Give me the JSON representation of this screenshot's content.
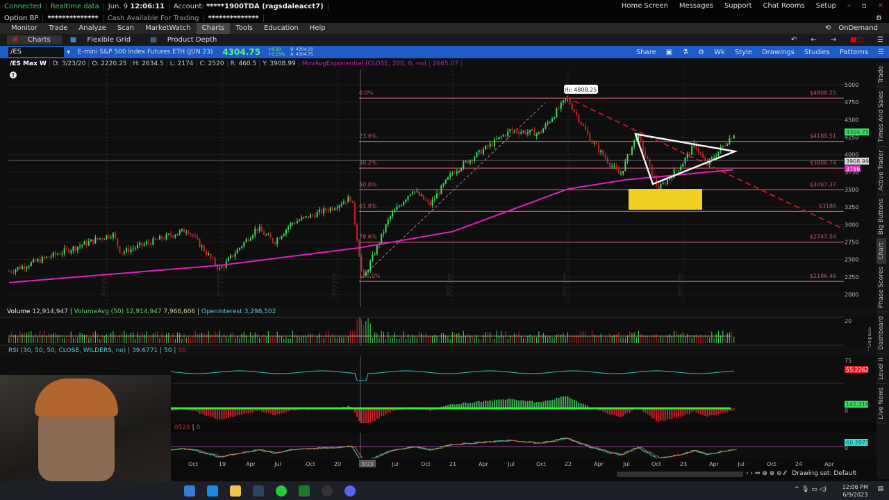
{
  "status": {
    "connected": "Connected",
    "realtime": "Realtime data",
    "date": "Jun. 9",
    "time": "12:06:11",
    "account_label": "Account:",
    "account": "*****1900TDA (ragsdaleacct7)",
    "option_bp": "Option BP",
    "option_bp_value": "**************",
    "cash_label": "Cash Available For Trading",
    "cash_value": "**************"
  },
  "top_links": [
    "Home Screen",
    "Messages",
    "Support",
    "Chat Rooms",
    "Setup"
  ],
  "menu": [
    "Monitor",
    "Trade",
    "Analyze",
    "Scan",
    "MarketWatch",
    "Charts",
    "Tools",
    "Education",
    "Help"
  ],
  "subtabs": [
    "Charts",
    "Flexible Grid",
    "Product Depth"
  ],
  "ondemand": "OnDemand",
  "symbol_bar": {
    "symbol": "/ES",
    "description": "E-mini S&P 500 Index Futures.ETH (JUN 23)",
    "last": "4304.75",
    "change": "+6.50",
    "change_pct": "+0.15%",
    "bid": "B: 4304.50",
    "ask": "A: 4304.75",
    "tools": [
      "Share",
      "Wk",
      "Style",
      "Drawings",
      "Studies",
      "Patterns"
    ]
  },
  "chart_info": {
    "name": "/ES Max W",
    "D": "D: 3/23/20",
    "O": "O: 2220.25",
    "H": "H: 2634.5",
    "L": "L: 2174",
    "C": "C: 2520",
    "R": "R: 460.5",
    "Y": "Y: 3908.99",
    "study": "MovAvgExponential (CLOSE, 200, 0, no)",
    "study_value": "2665.07"
  },
  "price_axis": [
    "5000",
    "4750",
    "4500",
    "4250",
    "4000",
    "3750",
    "3500",
    "3250",
    "3000",
    "2750",
    "2500",
    "2250",
    "2000"
  ],
  "price_badges": {
    "last": "4304.75",
    "cursor": "3908.99",
    "ema": "3786"
  },
  "hi_label": "Hi: 4808.25",
  "fib": [
    {
      "pct": "0.0%",
      "price": "$4808.25",
      "v": 4808.25
    },
    {
      "pct": "23.6%",
      "price": "$4189.51",
      "v": 4189.51
    },
    {
      "pct": "38.2%",
      "price": "$3806.74",
      "v": 3806.74
    },
    {
      "pct": "50.0%",
      "price": "$3497.37",
      "v": 3497.37
    },
    {
      "pct": "61.8%",
      "price": "$3188",
      "v": 3188
    },
    {
      "pct": "78.6%",
      "price": "$2747.54",
      "v": 2747.54
    },
    {
      "pct": "100.0%",
      "price": "$2186.48",
      "v": 2186.48
    }
  ],
  "year_marks": [
    "2018 year",
    "2019 year",
    "2020 year",
    "2021 year",
    "2022 year",
    "2023 year"
  ],
  "volume": {
    "label": "Volume",
    "value": "12,914,947",
    "avg_label": "VolumeAvg (50)",
    "avg_value": "12,914,947",
    "avg2": "7,966,606",
    "oi_label": "OpenInterest",
    "oi_value": "3,298,502",
    "axis": "20",
    "unit": "<million..."
  },
  "rsi": {
    "label": "RSI (30, 50, 50, CLOSE, WILDERS, no)",
    "value": "39.6771",
    "v2": "50",
    "v3": "50",
    "axis_top": "75",
    "badge": "55.2262"
  },
  "hist": {
    "badge": "142.219",
    "zero": "0"
  },
  "osc": {
    "v1": ".0528",
    "v2": "0",
    "badge": "60.2071",
    "zero": "0"
  },
  "time_axis": [
    "Oct",
    "19",
    "Apr",
    "Jul",
    "Oct",
    "20",
    "3/23",
    "Jul",
    "Oct",
    "21",
    "Apr",
    "Jul",
    "Oct",
    "22",
    "Apr",
    "Jul",
    "Oct",
    "23",
    "Apr",
    "Jul",
    "Oct",
    "24",
    "Apr"
  ],
  "drawing_set": "Drawing set: Default",
  "side_tabs": [
    "Trade",
    "Times And Sales",
    "Active Trader",
    "Big Buttons",
    "Chart",
    "Phase Scores",
    "Dashboard",
    "Level II",
    "Live News"
  ],
  "clock": {
    "time": "12:06 PM",
    "date": "6/9/2023"
  },
  "price_path": [
    [
      2017.15,
      2330
    ],
    [
      2018.05,
      2870
    ],
    [
      2018.12,
      2600
    ],
    [
      2018.7,
      2930
    ],
    [
      2018.98,
      2350
    ],
    [
      2019.3,
      2950
    ],
    [
      2019.45,
      2750
    ],
    [
      2019.6,
      3020
    ],
    [
      2019.95,
      3240
    ],
    [
      2020.12,
      3390
    ],
    [
      2020.22,
      2200
    ],
    [
      2020.45,
      3100
    ],
    [
      2020.65,
      3500
    ],
    [
      2020.8,
      3280
    ],
    [
      2021.0,
      3750
    ],
    [
      2021.5,
      4350
    ],
    [
      2021.75,
      4300
    ],
    [
      2021.99,
      4808
    ],
    [
      2022.2,
      4200
    ],
    [
      2022.45,
      3700
    ],
    [
      2022.6,
      4300
    ],
    [
      2022.78,
      3500
    ],
    [
      2022.98,
      3850
    ],
    [
      2023.1,
      4150
    ],
    [
      2023.2,
      3850
    ],
    [
      2023.44,
      4305
    ]
  ],
  "ema_path": [
    [
      2017.15,
      2170
    ],
    [
      2019.0,
      2420
    ],
    [
      2020.2,
      2670
    ],
    [
      2021.0,
      2900
    ],
    [
      2022.0,
      3510
    ],
    [
      2022.5,
      3640
    ],
    [
      2023.44,
      3786
    ]
  ],
  "colors": {
    "up": "#3ddc5a",
    "down": "#c8202a",
    "ema": "#e020c0",
    "fib": "#b85a64",
    "accent": "#1e5bc6",
    "zone": "#f0d020"
  }
}
